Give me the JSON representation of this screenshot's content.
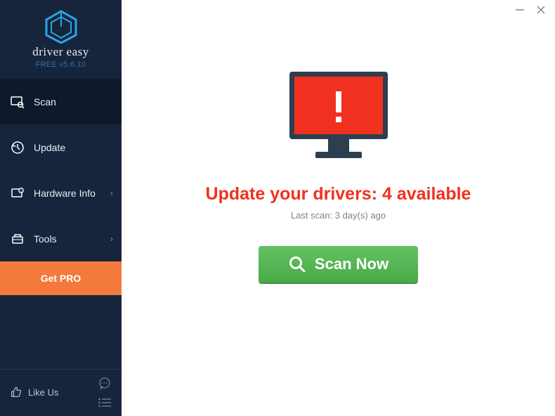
{
  "brand": "driver easy",
  "version": "FREE v5.6.10",
  "sidebar": {
    "items": [
      {
        "label": "Scan"
      },
      {
        "label": "Update"
      },
      {
        "label": "Hardware Info"
      },
      {
        "label": "Tools"
      }
    ],
    "get_pro": "Get PRO",
    "like_us": "Like Us"
  },
  "main": {
    "headline": "Update your drivers: 4 available",
    "subtext": "Last scan: 3 day(s) ago",
    "scan_label": "Scan Now"
  }
}
